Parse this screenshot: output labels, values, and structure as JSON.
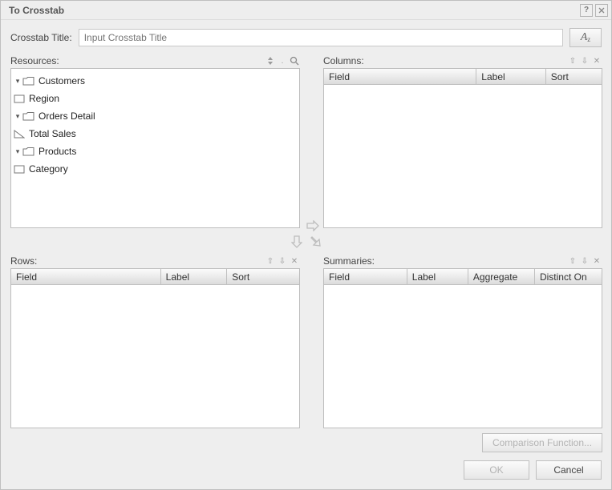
{
  "window": {
    "title": "To Crosstab"
  },
  "titleRow": {
    "label": "Crosstab Title:",
    "placeholder": "Input Crosstab Title",
    "fontButtonGlyph": "A"
  },
  "resources": {
    "label": "Resources:",
    "tree": [
      {
        "kind": "folder",
        "label": "Customers"
      },
      {
        "kind": "field",
        "label": "Region",
        "icon": "rect"
      },
      {
        "kind": "folder",
        "label": "Orders Detail"
      },
      {
        "kind": "field",
        "label": "Total Sales",
        "icon": "tri"
      },
      {
        "kind": "folder",
        "label": "Products"
      },
      {
        "kind": "field",
        "label": "Category",
        "icon": "rect"
      }
    ]
  },
  "columns": {
    "label": "Columns:",
    "headers": {
      "field": "Field",
      "labelCol": "Label",
      "sort": "Sort"
    }
  },
  "rows": {
    "label": "Rows:",
    "headers": {
      "field": "Field",
      "labelCol": "Label",
      "sort": "Sort"
    }
  },
  "summaries": {
    "label": "Summaries:",
    "headers": {
      "field": "Field",
      "labelCol": "Label",
      "aggregate": "Aggregate",
      "distinct": "Distinct On"
    }
  },
  "buttons": {
    "comparison": "Comparison Function...",
    "ok": "OK",
    "cancel": "Cancel"
  }
}
